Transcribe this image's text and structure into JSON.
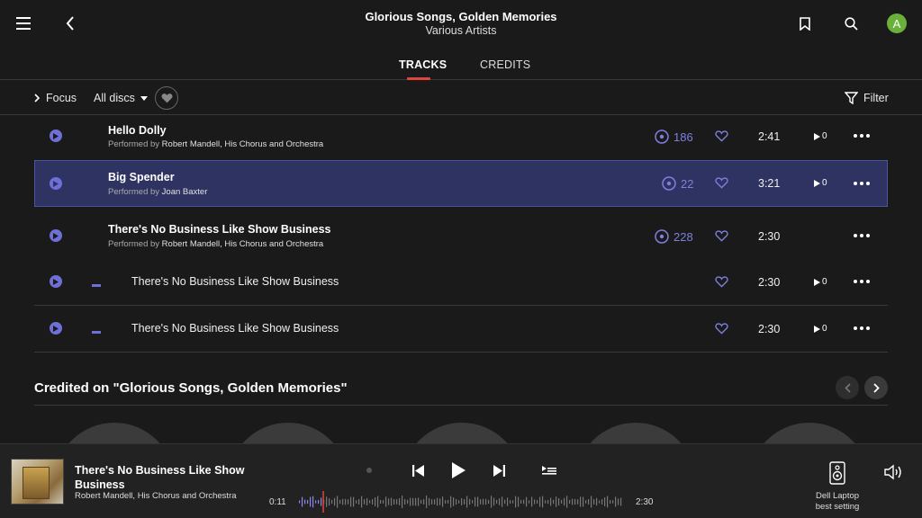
{
  "header": {
    "album_title": "Glorious Songs, Golden Memories",
    "album_artist": "Various Artists",
    "avatar_letter": "A",
    "avatar_color": "#6ab13a"
  },
  "tabs": [
    {
      "label": "TRACKS",
      "active": true
    },
    {
      "label": "CREDITS",
      "active": false
    }
  ],
  "filter_bar": {
    "focus_label": "Focus",
    "discs_label": "All discs",
    "filter_label": "Filter"
  },
  "tracks": [
    {
      "title": "Hello Dolly",
      "performed_prefix": "Performed by",
      "performer": "Robert Mandell, His Chorus and Orchestra",
      "plays": "186",
      "duration": "2:41",
      "play_count": "0"
    },
    {
      "title": "Big Spender",
      "performed_prefix": "Performed by",
      "performer": "Joan Baxter",
      "plays": "22",
      "duration": "3:21",
      "play_count": "0",
      "selected": true
    },
    {
      "title": "There's No Business Like Show Business",
      "performed_prefix": "Performed by",
      "performer": "Robert Mandell, His Chorus and Orchestra",
      "plays": "228",
      "duration": "2:30"
    },
    {
      "title": "There's No Business Like Show Business",
      "duration": "2:30",
      "play_count": "0",
      "sub": true
    },
    {
      "title": "There's No Business Like Show Business",
      "duration": "2:30",
      "play_count": "0",
      "sub": true
    }
  ],
  "credited": {
    "title": "Credited on \"Glorious Songs, Golden Memories\""
  },
  "player": {
    "track_title": "There's No Business Like Show Business",
    "track_artist": "Robert Mandell, His Chorus and Orchestra",
    "elapsed": "0:11",
    "total": "2:30",
    "progress_fraction": 0.073,
    "device_name": "Dell Laptop",
    "device_setting": "best setting"
  },
  "colors": {
    "accent": "#6f6fd8",
    "selected_row": "#2e3362",
    "tab_underline": "#e0463c",
    "background": "#1a1a1a"
  }
}
